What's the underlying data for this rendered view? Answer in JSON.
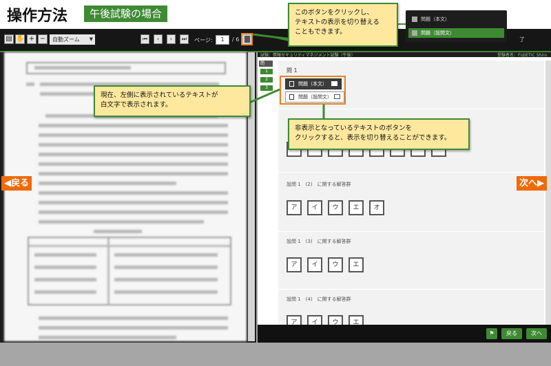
{
  "header": {
    "title": "操作方法",
    "subtitle": "午後試験の場合"
  },
  "toolbar": {
    "zoom_value": "自動ズーム",
    "page_label": "ページ:",
    "page_value": "1",
    "page_total": "/ 6",
    "end_label": "了"
  },
  "exam_bar": {
    "exam": "試験：情報セキュリティマネジメント試験（午後）",
    "examinee": "受験者名：FUJIETIC Shiro"
  },
  "side_tabs": [
    "1",
    "2",
    "3"
  ],
  "side_head": "問",
  "question": {
    "label": "問 1",
    "doc_buttons": [
      {
        "label": "問題（本文）",
        "active": true
      },
      {
        "label": "問題（設問文）",
        "active": false
      }
    ],
    "groups": [
      {
        "label": "設問 1　(2)　に関する解答群",
        "choices": [
          "ア",
          "イ",
          "ウ",
          "エ",
          "オ"
        ]
      },
      {
        "label": "設問 1　(3)　に関する解答群",
        "choices": [
          "ア",
          "イ",
          "ウ",
          "エ"
        ]
      },
      {
        "label": "設問 1　(4)　に関する解答群",
        "choices": [
          "ア",
          "イ",
          "ウ",
          "エ"
        ]
      }
    ],
    "top_choices": [
      "",
      "",
      "",
      "",
      "",
      "",
      "",
      ""
    ]
  },
  "bottom": {
    "back": "戻る",
    "next": "次へ"
  },
  "big_nav": {
    "prev": "戻る",
    "next": "次へ"
  },
  "callouts": {
    "toggle": "このボタンをクリックし、\nテキストの表示を切り替える\nこともできます。",
    "current": "現在、左側に表示されているテキストが\n白文字で表示されます。",
    "hidden": "非表示となっているテキストのボタンを\nクリックすると、表示を切り替えることができます。"
  },
  "popup": [
    {
      "label": "問題（本文）",
      "active": false
    },
    {
      "label": "問題（設問文）",
      "active": true
    }
  ],
  "colors": {
    "accent_green": "#3e8a32",
    "accent_orange": "#f06a09",
    "callout_bg": "#fde89e"
  }
}
